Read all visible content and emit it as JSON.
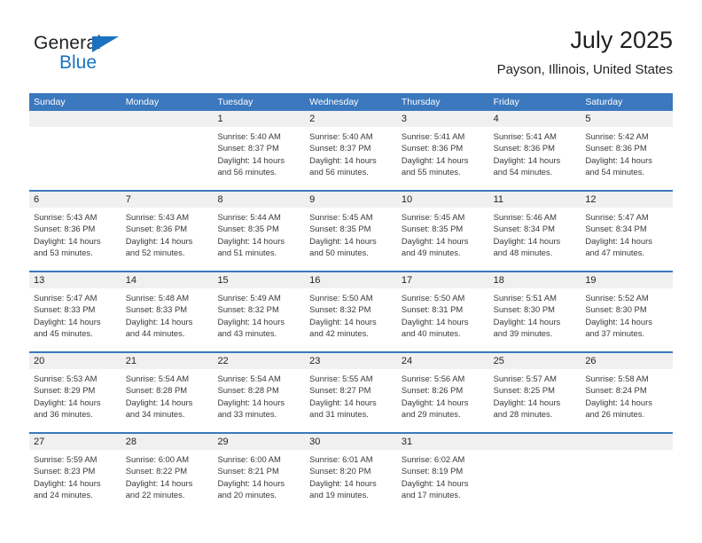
{
  "brand": {
    "name_part1": "General",
    "name_part2": "Blue",
    "triangle_color": "#1a72c0"
  },
  "header": {
    "title": "July 2025",
    "subtitle": "Payson, Illinois, United States"
  },
  "colors": {
    "header_blue": "#3b78be",
    "daynum_band": "#f0f0f0",
    "text": "#231f20"
  },
  "weekdays": [
    "Sunday",
    "Monday",
    "Tuesday",
    "Wednesday",
    "Thursday",
    "Friday",
    "Saturday"
  ],
  "weeks": [
    [
      {
        "day": "",
        "lines": []
      },
      {
        "day": "",
        "lines": []
      },
      {
        "day": "1",
        "lines": [
          "Sunrise: 5:40 AM",
          "Sunset: 8:37 PM",
          "Daylight: 14 hours",
          "and 56 minutes."
        ]
      },
      {
        "day": "2",
        "lines": [
          "Sunrise: 5:40 AM",
          "Sunset: 8:37 PM",
          "Daylight: 14 hours",
          "and 56 minutes."
        ]
      },
      {
        "day": "3",
        "lines": [
          "Sunrise: 5:41 AM",
          "Sunset: 8:36 PM",
          "Daylight: 14 hours",
          "and 55 minutes."
        ]
      },
      {
        "day": "4",
        "lines": [
          "Sunrise: 5:41 AM",
          "Sunset: 8:36 PM",
          "Daylight: 14 hours",
          "and 54 minutes."
        ]
      },
      {
        "day": "5",
        "lines": [
          "Sunrise: 5:42 AM",
          "Sunset: 8:36 PM",
          "Daylight: 14 hours",
          "and 54 minutes."
        ]
      }
    ],
    [
      {
        "day": "6",
        "lines": [
          "Sunrise: 5:43 AM",
          "Sunset: 8:36 PM",
          "Daylight: 14 hours",
          "and 53 minutes."
        ]
      },
      {
        "day": "7",
        "lines": [
          "Sunrise: 5:43 AM",
          "Sunset: 8:36 PM",
          "Daylight: 14 hours",
          "and 52 minutes."
        ]
      },
      {
        "day": "8",
        "lines": [
          "Sunrise: 5:44 AM",
          "Sunset: 8:35 PM",
          "Daylight: 14 hours",
          "and 51 minutes."
        ]
      },
      {
        "day": "9",
        "lines": [
          "Sunrise: 5:45 AM",
          "Sunset: 8:35 PM",
          "Daylight: 14 hours",
          "and 50 minutes."
        ]
      },
      {
        "day": "10",
        "lines": [
          "Sunrise: 5:45 AM",
          "Sunset: 8:35 PM",
          "Daylight: 14 hours",
          "and 49 minutes."
        ]
      },
      {
        "day": "11",
        "lines": [
          "Sunrise: 5:46 AM",
          "Sunset: 8:34 PM",
          "Daylight: 14 hours",
          "and 48 minutes."
        ]
      },
      {
        "day": "12",
        "lines": [
          "Sunrise: 5:47 AM",
          "Sunset: 8:34 PM",
          "Daylight: 14 hours",
          "and 47 minutes."
        ]
      }
    ],
    [
      {
        "day": "13",
        "lines": [
          "Sunrise: 5:47 AM",
          "Sunset: 8:33 PM",
          "Daylight: 14 hours",
          "and 45 minutes."
        ]
      },
      {
        "day": "14",
        "lines": [
          "Sunrise: 5:48 AM",
          "Sunset: 8:33 PM",
          "Daylight: 14 hours",
          "and 44 minutes."
        ]
      },
      {
        "day": "15",
        "lines": [
          "Sunrise: 5:49 AM",
          "Sunset: 8:32 PM",
          "Daylight: 14 hours",
          "and 43 minutes."
        ]
      },
      {
        "day": "16",
        "lines": [
          "Sunrise: 5:50 AM",
          "Sunset: 8:32 PM",
          "Daylight: 14 hours",
          "and 42 minutes."
        ]
      },
      {
        "day": "17",
        "lines": [
          "Sunrise: 5:50 AM",
          "Sunset: 8:31 PM",
          "Daylight: 14 hours",
          "and 40 minutes."
        ]
      },
      {
        "day": "18",
        "lines": [
          "Sunrise: 5:51 AM",
          "Sunset: 8:30 PM",
          "Daylight: 14 hours",
          "and 39 minutes."
        ]
      },
      {
        "day": "19",
        "lines": [
          "Sunrise: 5:52 AM",
          "Sunset: 8:30 PM",
          "Daylight: 14 hours",
          "and 37 minutes."
        ]
      }
    ],
    [
      {
        "day": "20",
        "lines": [
          "Sunrise: 5:53 AM",
          "Sunset: 8:29 PM",
          "Daylight: 14 hours",
          "and 36 minutes."
        ]
      },
      {
        "day": "21",
        "lines": [
          "Sunrise: 5:54 AM",
          "Sunset: 8:28 PM",
          "Daylight: 14 hours",
          "and 34 minutes."
        ]
      },
      {
        "day": "22",
        "lines": [
          "Sunrise: 5:54 AM",
          "Sunset: 8:28 PM",
          "Daylight: 14 hours",
          "and 33 minutes."
        ]
      },
      {
        "day": "23",
        "lines": [
          "Sunrise: 5:55 AM",
          "Sunset: 8:27 PM",
          "Daylight: 14 hours",
          "and 31 minutes."
        ]
      },
      {
        "day": "24",
        "lines": [
          "Sunrise: 5:56 AM",
          "Sunset: 8:26 PM",
          "Daylight: 14 hours",
          "and 29 minutes."
        ]
      },
      {
        "day": "25",
        "lines": [
          "Sunrise: 5:57 AM",
          "Sunset: 8:25 PM",
          "Daylight: 14 hours",
          "and 28 minutes."
        ]
      },
      {
        "day": "26",
        "lines": [
          "Sunrise: 5:58 AM",
          "Sunset: 8:24 PM",
          "Daylight: 14 hours",
          "and 26 minutes."
        ]
      }
    ],
    [
      {
        "day": "27",
        "lines": [
          "Sunrise: 5:59 AM",
          "Sunset: 8:23 PM",
          "Daylight: 14 hours",
          "and 24 minutes."
        ]
      },
      {
        "day": "28",
        "lines": [
          "Sunrise: 6:00 AM",
          "Sunset: 8:22 PM",
          "Daylight: 14 hours",
          "and 22 minutes."
        ]
      },
      {
        "day": "29",
        "lines": [
          "Sunrise: 6:00 AM",
          "Sunset: 8:21 PM",
          "Daylight: 14 hours",
          "and 20 minutes."
        ]
      },
      {
        "day": "30",
        "lines": [
          "Sunrise: 6:01 AM",
          "Sunset: 8:20 PM",
          "Daylight: 14 hours",
          "and 19 minutes."
        ]
      },
      {
        "day": "31",
        "lines": [
          "Sunrise: 6:02 AM",
          "Sunset: 8:19 PM",
          "Daylight: 14 hours",
          "and 17 minutes."
        ]
      },
      {
        "day": "",
        "lines": []
      },
      {
        "day": "",
        "lines": []
      }
    ]
  ]
}
